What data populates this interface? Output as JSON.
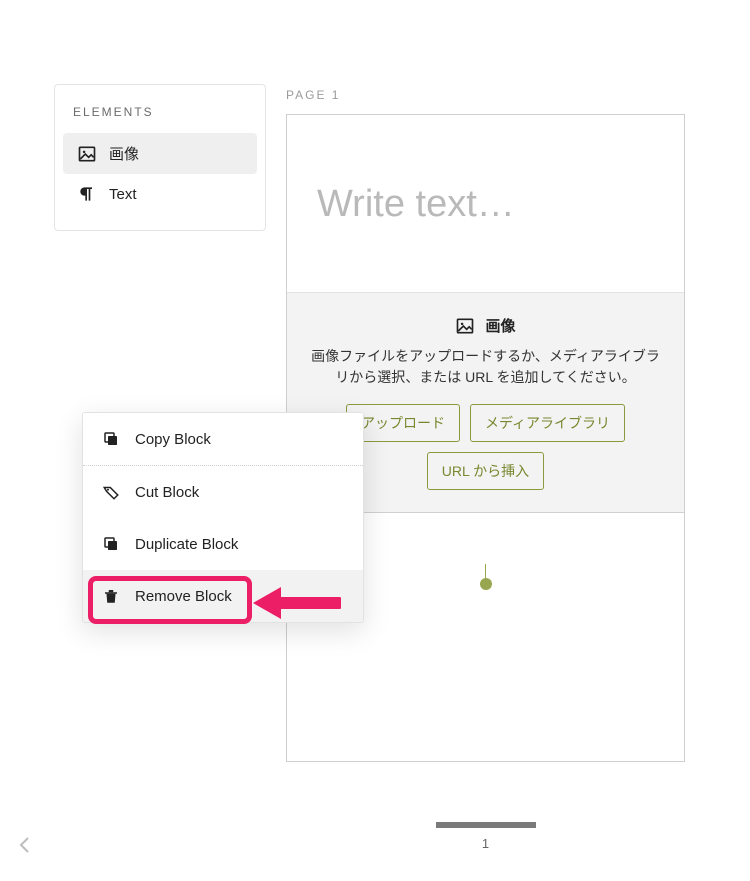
{
  "sidebar": {
    "title": "ELEMENTS",
    "items": [
      {
        "label": "画像",
        "icon": "image-icon",
        "active": true
      },
      {
        "label": "Text",
        "icon": "paragraph-icon",
        "active": false
      }
    ]
  },
  "page": {
    "header": "PAGE 1",
    "placeholder": "Write text…",
    "image_block": {
      "title": "画像",
      "description": "画像ファイルをアップロードするか、メディアライブラリから選択、または URL を追加してください。",
      "buttons": {
        "upload": "アップロード",
        "media_library": "メディアライブラリ",
        "from_url": "URL から挿入"
      }
    }
  },
  "context_menu": {
    "copy": "Copy Block",
    "cut": "Cut Block",
    "duplicate": "Duplicate Block",
    "remove": "Remove Block"
  },
  "pager": {
    "current": "1"
  },
  "colors": {
    "accent_olive": "#8a9a3b",
    "highlight_pink": "#ec1e66"
  }
}
